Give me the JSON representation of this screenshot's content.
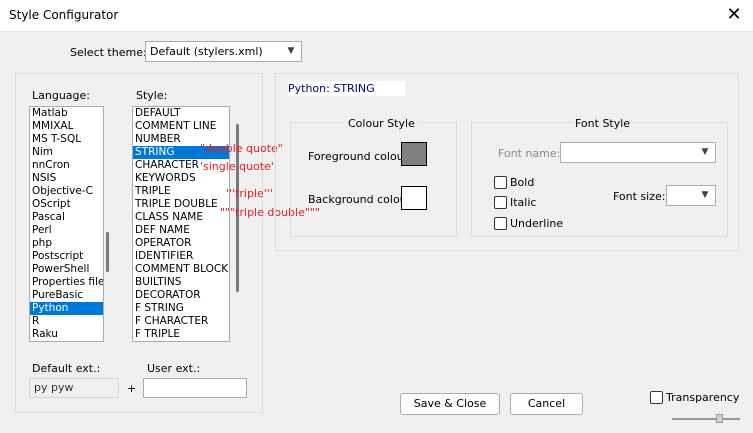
{
  "window": {
    "title": "Style Configurator",
    "close_glyph": "✕"
  },
  "theme": {
    "label": "Select theme:",
    "value": "Default (stylers.xml)"
  },
  "language": {
    "label": "Language:",
    "items": [
      "Matlab",
      "MMIXAL",
      "MS T-SQL",
      "Nim",
      "nnCron",
      "NSIS",
      "Objective-C",
      "OScript",
      "Pascal",
      "Perl",
      "php",
      "Postscript",
      "PowerShell",
      "Properties file",
      "PureBasic",
      "Python",
      "R",
      "Raku"
    ],
    "selected_index": 15
  },
  "style": {
    "label": "Style:",
    "items": [
      "DEFAULT",
      "COMMENT LINE",
      "NUMBER",
      "STRING",
      "CHARACTER",
      "KEYWORDS",
      "TRIPLE",
      "TRIPLE DOUBLE",
      "CLASS NAME",
      "DEF NAME",
      "OPERATOR",
      "IDENTIFIER",
      "COMMENT BLOCK",
      "BUILTINS",
      "DECORATOR",
      "F STRING",
      "F CHARACTER",
      "F TRIPLE"
    ],
    "selected_index": 3
  },
  "preview": {
    "double_quote": "\"double quote\"",
    "single_quote": "'single quote'",
    "triple": "'''triple'''",
    "triple_double": "\"\"\"triple double\"\"\""
  },
  "header": {
    "style_title": "Python: STRING"
  },
  "colour_style": {
    "title": "Colour Style",
    "foreground_label": "Foreground colour",
    "background_label": "Background colour",
    "foreground_color": "#808080",
    "background_color": "#ffffff"
  },
  "font_style": {
    "title": "Font Style",
    "font_name_label": "Font name:",
    "font_size_label": "Font size:",
    "bold_label": "Bold",
    "italic_label": "Italic",
    "underline_label": "Underline"
  },
  "ext": {
    "default_label": "Default ext.:",
    "default_value": "py pyw",
    "plus": "+",
    "user_label": "User ext.:",
    "user_value": ""
  },
  "buttons": {
    "save_close": "Save & Close",
    "cancel": "Cancel"
  },
  "transparency": {
    "label": "Transparency"
  },
  "icons": {
    "close": "close-icon",
    "dropdown": "chevron-down-icon"
  },
  "colors": {
    "selection": "#0078d7",
    "preview_text": "#e02020",
    "header_text": "#000080"
  }
}
